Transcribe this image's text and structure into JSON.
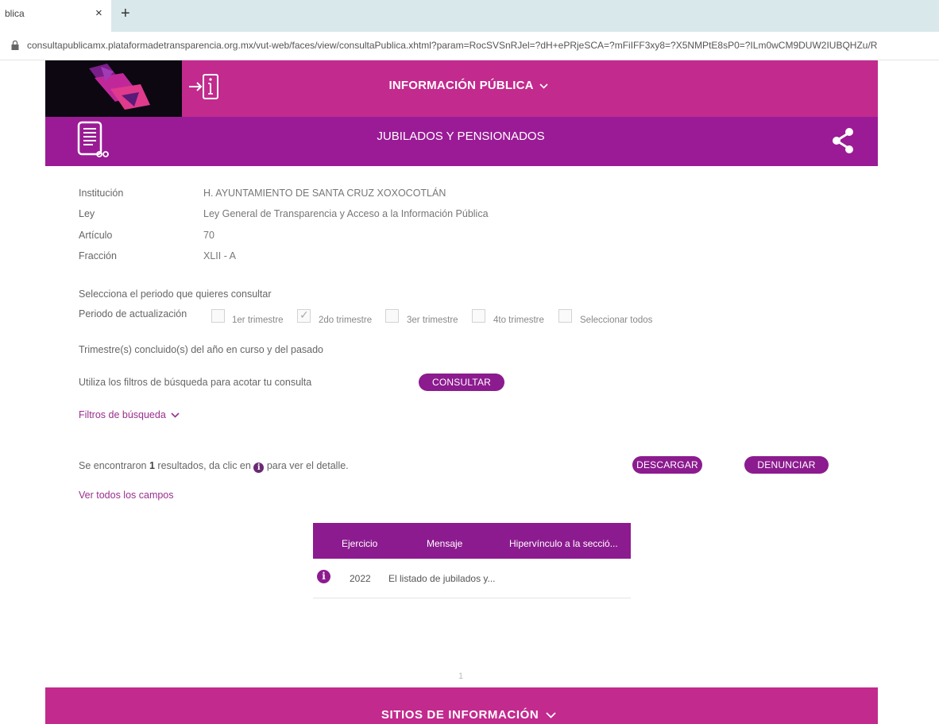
{
  "browser": {
    "tab_title": "blica",
    "close_glyph": "×",
    "new_tab_glyph": "+",
    "url": "consultapublicamx.plataformadetransparencia.org.mx/vut-web/faces/view/consultaPublica.xhtml?param=RocSVSnRJel=?dH+ePRjeSCA=?mFiIFF3xy8=?X5NMPtE8sP0=?ILm0wCM9DUW2IUBQHZu/R"
  },
  "header": {
    "title": "INFORMACIÓN PÚBLICA",
    "subtitle": "JUBILADOS Y PENSIONADOS"
  },
  "info": {
    "institucion_label": "Institución",
    "institucion_value": "H. AYUNTAMIENTO DE SANTA CRUZ XOXOCOTLÁN",
    "ley_label": "Ley",
    "ley_value": "Ley General de Transparencia y Acceso a la Información Pública",
    "articulo_label": "Artículo",
    "articulo_value": "70",
    "fraccion_label": "Fracción",
    "fraccion_value": "XLII - A"
  },
  "period": {
    "prompt": "Selecciona el periodo que quieres consultar",
    "label": "Periodo de actualización",
    "options": [
      {
        "label": "1er trimestre",
        "checked": false
      },
      {
        "label": "2do trimestre",
        "checked": true
      },
      {
        "label": "3er trimestre",
        "checked": false
      },
      {
        "label": "4to trimestre",
        "checked": false
      },
      {
        "label": "Seleccionar todos",
        "checked": false
      }
    ],
    "note": "Trimestre(s) concluido(s) del año en curso y del pasado"
  },
  "filters": {
    "hint": "Utiliza los filtros de búsqueda para acotar tu consulta",
    "consultar_label": "CONSULTAR",
    "toggle_label": "Filtros de búsqueda"
  },
  "results": {
    "summary_pre": "Se encontraron",
    "summary_count": "1",
    "summary_mid": "resultados, da clic en",
    "summary_post": "para ver el detalle.",
    "descargar_label": "DESCARGAR",
    "denunciar_label": "DENUNCIAR",
    "ver_todos_label": "Ver todos los campos"
  },
  "table": {
    "columns": [
      "Ejercicio",
      "Mensaje",
      "Hipervínculo a la secció..."
    ],
    "rows": [
      {
        "ejercicio": "2022",
        "mensaje": "El listado de jubilados y..."
      }
    ],
    "info_glyph": "i",
    "page": "1"
  },
  "footer": {
    "title": "SITIOS DE INFORMACIÓN"
  },
  "colors": {
    "magenta": "#c22a8e",
    "purple": "#9a1b95",
    "button": "#8c1b8f"
  }
}
